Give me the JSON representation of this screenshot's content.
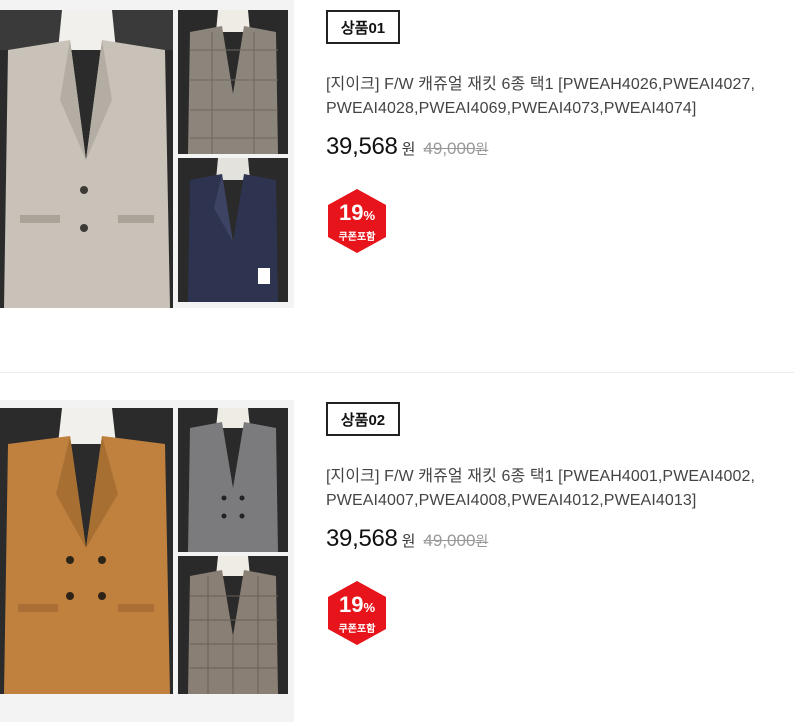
{
  "products": [
    {
      "badge": "상품01",
      "title": "[지이크] F/W 캐쥬얼 재킷 6종 택1 [PWEAH4026,PWEAI4027,PWEAI4028,PWEAI4069,PWEAI4073,PWEAI4074]",
      "sale_price": "39,568",
      "sale_unit": "원",
      "original_price": "49,000",
      "original_unit": "원",
      "discount_percent": "19",
      "percent_sign": "%",
      "coupon_label": "쿠폰포함",
      "colors": {
        "main": "#c8c2b8",
        "thumb1": "#8c857c",
        "thumb2": "#2e3450"
      }
    },
    {
      "badge": "상품02",
      "title": "[지이크] F/W 캐쥬얼 재킷 6종 택1 [PWEAH4001,PWEAI4002,PWEAI4007,PWEAI4008,PWEAI4012,PWEAI4013]",
      "sale_price": "39,568",
      "sale_unit": "원",
      "original_price": "49,000",
      "original_unit": "원",
      "discount_percent": "19",
      "percent_sign": "%",
      "coupon_label": "쿠폰포함",
      "colors": {
        "main": "#c0813f",
        "thumb1": "#7b7a7c",
        "thumb2": "#8a7f74"
      }
    }
  ],
  "theme": {
    "coupon_red": "#e8141b"
  }
}
